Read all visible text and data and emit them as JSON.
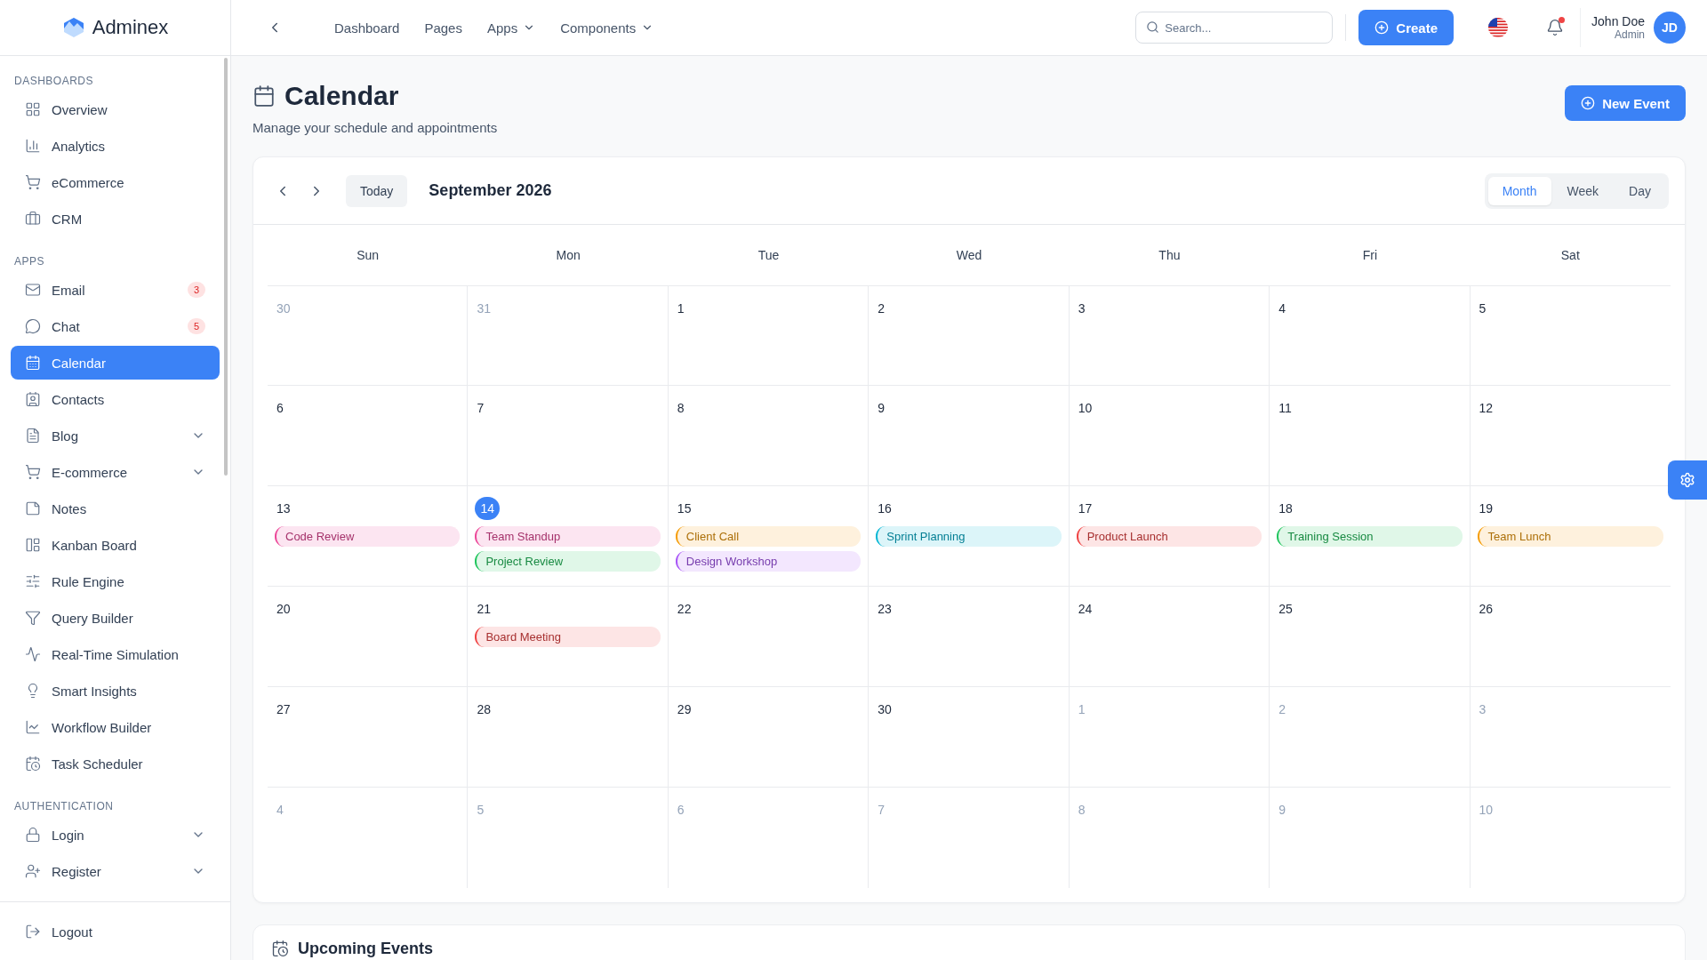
{
  "brand": {
    "name": "Adminex"
  },
  "topnav": {
    "items": [
      {
        "label": "Dashboard",
        "dropdown": false
      },
      {
        "label": "Pages",
        "dropdown": false
      },
      {
        "label": "Apps",
        "dropdown": true
      },
      {
        "label": "Components",
        "dropdown": true
      }
    ]
  },
  "search": {
    "placeholder": "Search..."
  },
  "create_button": {
    "label": "Create"
  },
  "notifications": {
    "unread": true
  },
  "user": {
    "name": "John Doe",
    "role": "Admin",
    "initials": "JD"
  },
  "sidebar": {
    "sections": [
      {
        "title": "DASHBOARDS",
        "items": [
          {
            "label": "Overview",
            "selected": false,
            "submenu": false
          },
          {
            "label": "Analytics",
            "selected": false,
            "submenu": false
          },
          {
            "label": "eCommerce",
            "selected": false,
            "submenu": false
          },
          {
            "label": "CRM",
            "selected": false,
            "submenu": false
          }
        ]
      },
      {
        "title": "APPS",
        "items": [
          {
            "label": "Email",
            "badge": "3",
            "selected": false,
            "submenu": false
          },
          {
            "label": "Chat",
            "badge": "5",
            "selected": false,
            "submenu": false
          },
          {
            "label": "Calendar",
            "selected": true,
            "submenu": false
          },
          {
            "label": "Contacts",
            "selected": false,
            "submenu": false
          },
          {
            "label": "Blog",
            "selected": false,
            "submenu": true
          },
          {
            "label": "E-commerce",
            "selected": false,
            "submenu": true
          },
          {
            "label": "Notes",
            "selected": false,
            "submenu": false
          },
          {
            "label": "Kanban Board",
            "selected": false,
            "submenu": false
          },
          {
            "label": "Rule Engine",
            "selected": false,
            "submenu": false
          },
          {
            "label": "Query Builder",
            "selected": false,
            "submenu": false
          },
          {
            "label": "Real-Time Simulation",
            "selected": false,
            "submenu": false
          },
          {
            "label": "Smart Insights",
            "selected": false,
            "submenu": false
          },
          {
            "label": "Workflow Builder",
            "selected": false,
            "submenu": false
          },
          {
            "label": "Task Scheduler",
            "selected": false,
            "submenu": false
          }
        ]
      },
      {
        "title": "AUTHENTICATION",
        "items": [
          {
            "label": "Login",
            "selected": false,
            "submenu": true
          },
          {
            "label": "Register",
            "selected": false,
            "submenu": true
          }
        ]
      }
    ],
    "footer": {
      "label": "Logout"
    }
  },
  "page": {
    "title": "Calendar",
    "subtitle": "Manage your schedule and appointments",
    "action": "New Event"
  },
  "calendar": {
    "today_label": "Today",
    "month": "September 2026",
    "views": [
      {
        "label": "Month",
        "selected": true
      },
      {
        "label": "Week",
        "selected": false
      },
      {
        "label": "Day",
        "selected": false
      }
    ],
    "weekdays": [
      "Sun",
      "Mon",
      "Tue",
      "Wed",
      "Thu",
      "Fri",
      "Sat"
    ],
    "weeks": [
      [
        {
          "date": "30",
          "in_month": false,
          "today": false
        },
        {
          "date": "31",
          "in_month": false,
          "today": false
        },
        {
          "date": "1",
          "in_month": true,
          "today": false
        },
        {
          "date": "2",
          "in_month": true,
          "today": false
        },
        {
          "date": "3",
          "in_month": true,
          "today": false
        },
        {
          "date": "4",
          "in_month": true,
          "today": false
        },
        {
          "date": "5",
          "in_month": true,
          "today": false
        }
      ],
      [
        {
          "date": "6",
          "in_month": true,
          "today": false
        },
        {
          "date": "7",
          "in_month": true,
          "today": false
        },
        {
          "date": "8",
          "in_month": true,
          "today": false
        },
        {
          "date": "9",
          "in_month": true,
          "today": false
        },
        {
          "date": "10",
          "in_month": true,
          "today": false
        },
        {
          "date": "11",
          "in_month": true,
          "today": false
        },
        {
          "date": "12",
          "in_month": true,
          "today": false
        }
      ],
      [
        {
          "date": "13",
          "in_month": true,
          "today": false,
          "events": [
            {
              "title": "Code Review",
              "color": "#ec4899"
            }
          ]
        },
        {
          "date": "14",
          "in_month": true,
          "today": true,
          "events": [
            {
              "title": "Team Standup",
              "color": "#ec4899"
            },
            {
              "title": "Project Review",
              "color": "#22c55e"
            }
          ]
        },
        {
          "date": "15",
          "in_month": true,
          "today": false,
          "events": [
            {
              "title": "Client Call",
              "color": "#f59e0b"
            },
            {
              "title": "Design Workshop",
              "color": "#a855f7"
            }
          ]
        },
        {
          "date": "16",
          "in_month": true,
          "today": false,
          "events": [
            {
              "title": "Sprint Planning",
              "color": "#06b6d4"
            }
          ]
        },
        {
          "date": "17",
          "in_month": true,
          "today": false,
          "events": [
            {
              "title": "Product Launch",
              "color": "#ef4444"
            }
          ]
        },
        {
          "date": "18",
          "in_month": true,
          "today": false,
          "events": [
            {
              "title": "Training Session",
              "color": "#22c55e"
            }
          ]
        },
        {
          "date": "19",
          "in_month": true,
          "today": false,
          "events": [
            {
              "title": "Team Lunch",
              "color": "#f59e0b"
            }
          ]
        }
      ],
      [
        {
          "date": "20",
          "in_month": true,
          "today": false
        },
        {
          "date": "21",
          "in_month": true,
          "today": false,
          "events": [
            {
              "title": "Board Meeting",
              "color": "#ef4444"
            }
          ]
        },
        {
          "date": "22",
          "in_month": true,
          "today": false
        },
        {
          "date": "23",
          "in_month": true,
          "today": false
        },
        {
          "date": "24",
          "in_month": true,
          "today": false
        },
        {
          "date": "25",
          "in_month": true,
          "today": false
        },
        {
          "date": "26",
          "in_month": true,
          "today": false
        }
      ],
      [
        {
          "date": "27",
          "in_month": true,
          "today": false
        },
        {
          "date": "28",
          "in_month": true,
          "today": false
        },
        {
          "date": "29",
          "in_month": true,
          "today": false
        },
        {
          "date": "30",
          "in_month": true,
          "today": false
        },
        {
          "date": "1",
          "in_month": false,
          "today": false
        },
        {
          "date": "2",
          "in_month": false,
          "today": false
        },
        {
          "date": "3",
          "in_month": false,
          "today": false
        }
      ],
      [
        {
          "date": "4",
          "in_month": false,
          "today": false
        },
        {
          "date": "5",
          "in_month": false,
          "today": false
        },
        {
          "date": "6",
          "in_month": false,
          "today": false
        },
        {
          "date": "7",
          "in_month": false,
          "today": false
        },
        {
          "date": "8",
          "in_month": false,
          "today": false
        },
        {
          "date": "9",
          "in_month": false,
          "today": false
        },
        {
          "date": "10",
          "in_month": false,
          "today": false
        }
      ]
    ]
  },
  "upcoming": {
    "title": "Upcoming Events"
  }
}
